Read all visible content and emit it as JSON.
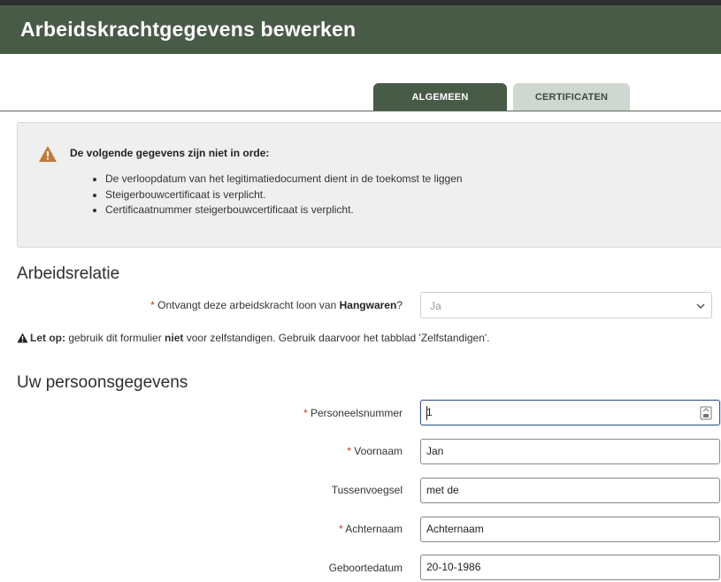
{
  "header": {
    "title": "Arbeidskrachtgegevens bewerken"
  },
  "tabs": [
    {
      "label": "ALGEMEEN",
      "active": true
    },
    {
      "label": "CERTIFICATEN",
      "active": false
    }
  ],
  "alert": {
    "title": "De volgende gegevens zijn niet in orde:",
    "items": [
      "De verloopdatum van het legitimatiedocument dient in de toekomst te liggen",
      "Steigerbouwcertificaat is verplicht.",
      "Certificaatnummer steigerbouwcertificaat is verplicht."
    ],
    "icon": "warning-triangle-icon",
    "icon_color": "#c07a3a"
  },
  "arbeidsrelatie": {
    "title": "Arbeidsrelatie",
    "question_prefix": "Ontvangt deze arbeidskracht loon van ",
    "question_company": "Hangwaren",
    "question_suffix": "?",
    "answer": "Ja",
    "note_bold": "Let op:",
    "note_text_1": " gebruik dit formulier ",
    "note_bold_2": "niet",
    "note_text_2": " voor zelfstandigen. Gebruik daarvoor het tabblad 'Zelfstandigen'."
  },
  "persoonsgegevens": {
    "title": "Uw persoonsgegevens",
    "fields": [
      {
        "label": "Personeelsnummer",
        "value": "1",
        "required": true
      },
      {
        "label": "Voornaam",
        "value": "Jan",
        "required": true
      },
      {
        "label": "Tussenvoegsel",
        "value": "met de",
        "required": false
      },
      {
        "label": "Achternaam",
        "value": "Achternaam",
        "required": true
      },
      {
        "label": "Geboortedatum",
        "value": "20-10-1986",
        "required": false
      }
    ]
  },
  "required_marker": "*",
  "colors": {
    "header": "#485b47",
    "tab_inactive": "#cfd8d0",
    "required": "#c0392b"
  }
}
